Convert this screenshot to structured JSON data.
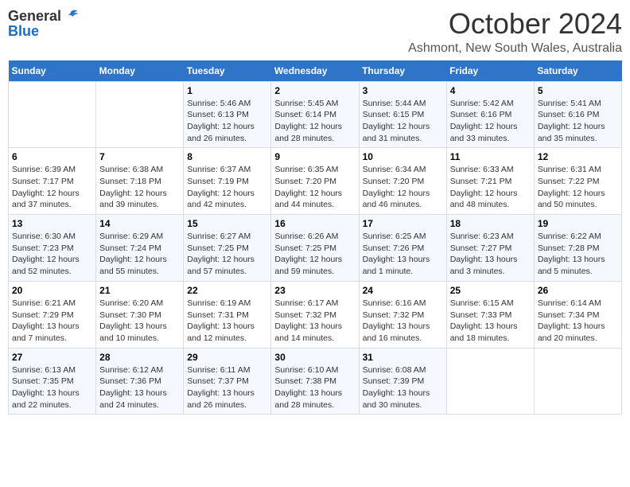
{
  "header": {
    "logo_general": "General",
    "logo_blue": "Blue",
    "title": "October 2024",
    "subtitle": "Ashmont, New South Wales, Australia"
  },
  "days_of_week": [
    "Sunday",
    "Monday",
    "Tuesday",
    "Wednesday",
    "Thursday",
    "Friday",
    "Saturday"
  ],
  "weeks": [
    [
      {
        "day": "",
        "info": ""
      },
      {
        "day": "",
        "info": ""
      },
      {
        "day": "1",
        "info": "Sunrise: 5:46 AM\nSunset: 6:13 PM\nDaylight: 12 hours and 26 minutes."
      },
      {
        "day": "2",
        "info": "Sunrise: 5:45 AM\nSunset: 6:14 PM\nDaylight: 12 hours and 28 minutes."
      },
      {
        "day": "3",
        "info": "Sunrise: 5:44 AM\nSunset: 6:15 PM\nDaylight: 12 hours and 31 minutes."
      },
      {
        "day": "4",
        "info": "Sunrise: 5:42 AM\nSunset: 6:16 PM\nDaylight: 12 hours and 33 minutes."
      },
      {
        "day": "5",
        "info": "Sunrise: 5:41 AM\nSunset: 6:16 PM\nDaylight: 12 hours and 35 minutes."
      }
    ],
    [
      {
        "day": "6",
        "info": "Sunrise: 6:39 AM\nSunset: 7:17 PM\nDaylight: 12 hours and 37 minutes."
      },
      {
        "day": "7",
        "info": "Sunrise: 6:38 AM\nSunset: 7:18 PM\nDaylight: 12 hours and 39 minutes."
      },
      {
        "day": "8",
        "info": "Sunrise: 6:37 AM\nSunset: 7:19 PM\nDaylight: 12 hours and 42 minutes."
      },
      {
        "day": "9",
        "info": "Sunrise: 6:35 AM\nSunset: 7:20 PM\nDaylight: 12 hours and 44 minutes."
      },
      {
        "day": "10",
        "info": "Sunrise: 6:34 AM\nSunset: 7:20 PM\nDaylight: 12 hours and 46 minutes."
      },
      {
        "day": "11",
        "info": "Sunrise: 6:33 AM\nSunset: 7:21 PM\nDaylight: 12 hours and 48 minutes."
      },
      {
        "day": "12",
        "info": "Sunrise: 6:31 AM\nSunset: 7:22 PM\nDaylight: 12 hours and 50 minutes."
      }
    ],
    [
      {
        "day": "13",
        "info": "Sunrise: 6:30 AM\nSunset: 7:23 PM\nDaylight: 12 hours and 52 minutes."
      },
      {
        "day": "14",
        "info": "Sunrise: 6:29 AM\nSunset: 7:24 PM\nDaylight: 12 hours and 55 minutes."
      },
      {
        "day": "15",
        "info": "Sunrise: 6:27 AM\nSunset: 7:25 PM\nDaylight: 12 hours and 57 minutes."
      },
      {
        "day": "16",
        "info": "Sunrise: 6:26 AM\nSunset: 7:25 PM\nDaylight: 12 hours and 59 minutes."
      },
      {
        "day": "17",
        "info": "Sunrise: 6:25 AM\nSunset: 7:26 PM\nDaylight: 13 hours and 1 minute."
      },
      {
        "day": "18",
        "info": "Sunrise: 6:23 AM\nSunset: 7:27 PM\nDaylight: 13 hours and 3 minutes."
      },
      {
        "day": "19",
        "info": "Sunrise: 6:22 AM\nSunset: 7:28 PM\nDaylight: 13 hours and 5 minutes."
      }
    ],
    [
      {
        "day": "20",
        "info": "Sunrise: 6:21 AM\nSunset: 7:29 PM\nDaylight: 13 hours and 7 minutes."
      },
      {
        "day": "21",
        "info": "Sunrise: 6:20 AM\nSunset: 7:30 PM\nDaylight: 13 hours and 10 minutes."
      },
      {
        "day": "22",
        "info": "Sunrise: 6:19 AM\nSunset: 7:31 PM\nDaylight: 13 hours and 12 minutes."
      },
      {
        "day": "23",
        "info": "Sunrise: 6:17 AM\nSunset: 7:32 PM\nDaylight: 13 hours and 14 minutes."
      },
      {
        "day": "24",
        "info": "Sunrise: 6:16 AM\nSunset: 7:32 PM\nDaylight: 13 hours and 16 minutes."
      },
      {
        "day": "25",
        "info": "Sunrise: 6:15 AM\nSunset: 7:33 PM\nDaylight: 13 hours and 18 minutes."
      },
      {
        "day": "26",
        "info": "Sunrise: 6:14 AM\nSunset: 7:34 PM\nDaylight: 13 hours and 20 minutes."
      }
    ],
    [
      {
        "day": "27",
        "info": "Sunrise: 6:13 AM\nSunset: 7:35 PM\nDaylight: 13 hours and 22 minutes."
      },
      {
        "day": "28",
        "info": "Sunrise: 6:12 AM\nSunset: 7:36 PM\nDaylight: 13 hours and 24 minutes."
      },
      {
        "day": "29",
        "info": "Sunrise: 6:11 AM\nSunset: 7:37 PM\nDaylight: 13 hours and 26 minutes."
      },
      {
        "day": "30",
        "info": "Sunrise: 6:10 AM\nSunset: 7:38 PM\nDaylight: 13 hours and 28 minutes."
      },
      {
        "day": "31",
        "info": "Sunrise: 6:08 AM\nSunset: 7:39 PM\nDaylight: 13 hours and 30 minutes."
      },
      {
        "day": "",
        "info": ""
      },
      {
        "day": "",
        "info": ""
      }
    ]
  ]
}
